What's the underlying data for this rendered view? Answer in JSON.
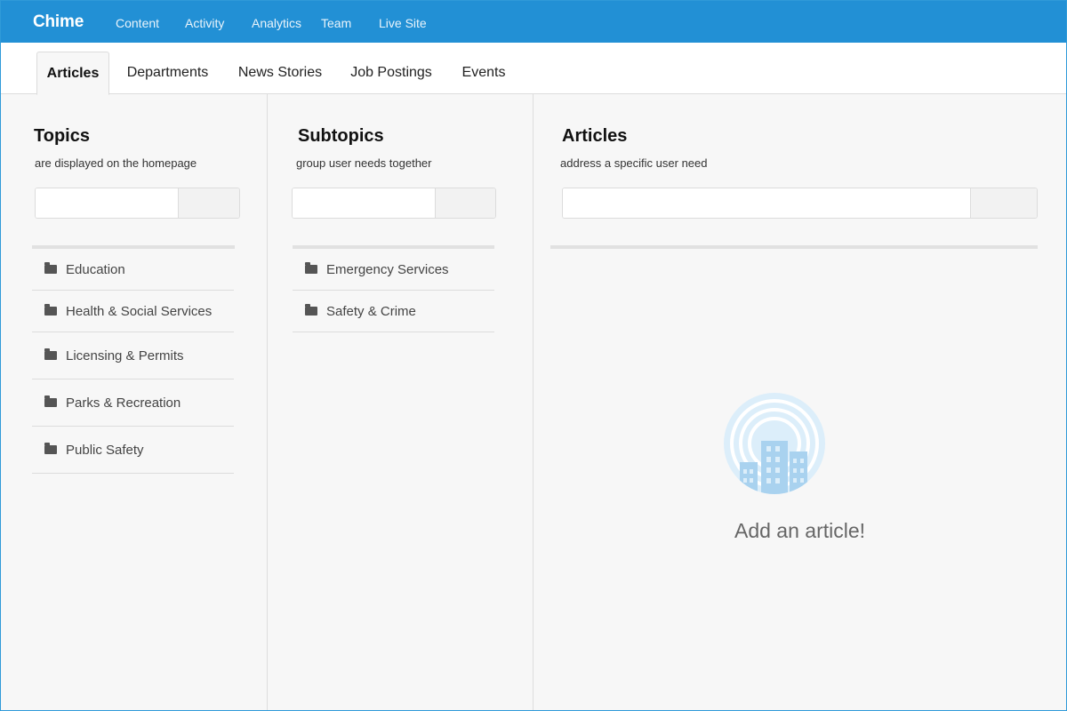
{
  "app": {
    "brand": "Chime"
  },
  "topnav": [
    "Content",
    "Activity",
    "Analytics",
    "Team",
    "Live Site"
  ],
  "tabs": [
    {
      "label": "Articles",
      "active": true
    },
    {
      "label": "Departments",
      "active": false
    },
    {
      "label": "News Stories",
      "active": false
    },
    {
      "label": "Job Postings",
      "active": false
    },
    {
      "label": "Events",
      "active": false
    }
  ],
  "columns": {
    "topics": {
      "title": "Topics",
      "subtitle": "are displayed on the homepage",
      "search_value": "",
      "items": [
        "Education",
        "Health & Social Services",
        "Licensing & Permits",
        "Parks & Recreation",
        "Public Safety"
      ]
    },
    "subtopics": {
      "title": "Subtopics",
      "subtitle": "group user needs together",
      "search_value": "",
      "items": [
        "Emergency Services",
        "Safety & Crime"
      ]
    },
    "articles": {
      "title": "Articles",
      "subtitle": "address a specific user need",
      "search_value": "",
      "empty_text": "Add an article!"
    }
  },
  "colors": {
    "topbar": "#2290d5",
    "illustration_circle": "#dceefa",
    "illustration_building": "#a9d2ef"
  },
  "icons": {
    "folder": "folder-icon",
    "empty_state": "city-buildings-icon"
  }
}
